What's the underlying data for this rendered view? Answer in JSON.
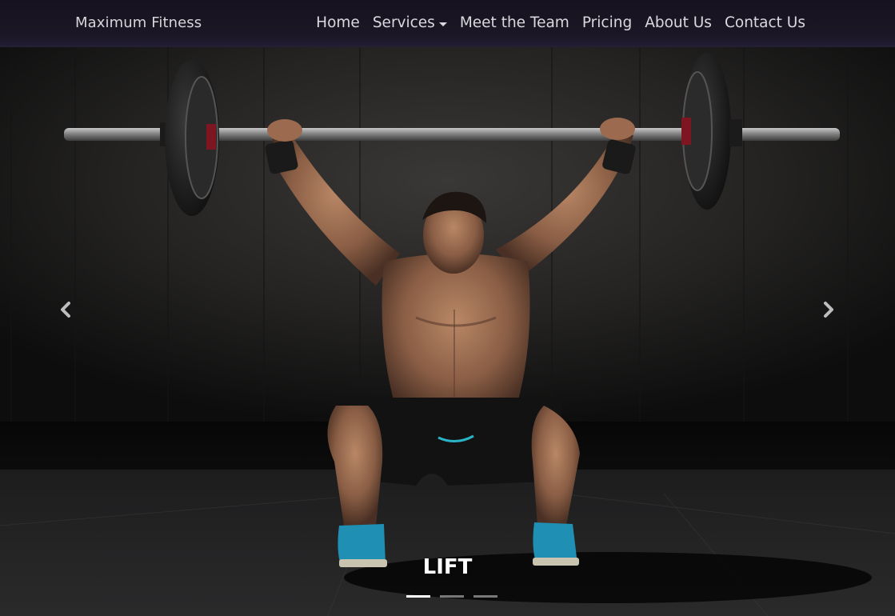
{
  "navbar": {
    "brand": "Maximum Fitness",
    "links": [
      {
        "label": "Home"
      },
      {
        "label": "Services",
        "has_dropdown": true
      },
      {
        "label": "Meet the Team"
      },
      {
        "label": "Pricing"
      },
      {
        "label": "About Us"
      },
      {
        "label": "Contact Us"
      }
    ]
  },
  "carousel": {
    "caption": "LIFT",
    "slide_count": 3,
    "active_index": 0,
    "prev_icon": "chevron-left-icon",
    "next_icon": "chevron-right-icon"
  },
  "colors": {
    "navbar_bg": "#1b1726",
    "nav_text": "#d9d9de",
    "caption_text": "#ffffff"
  }
}
